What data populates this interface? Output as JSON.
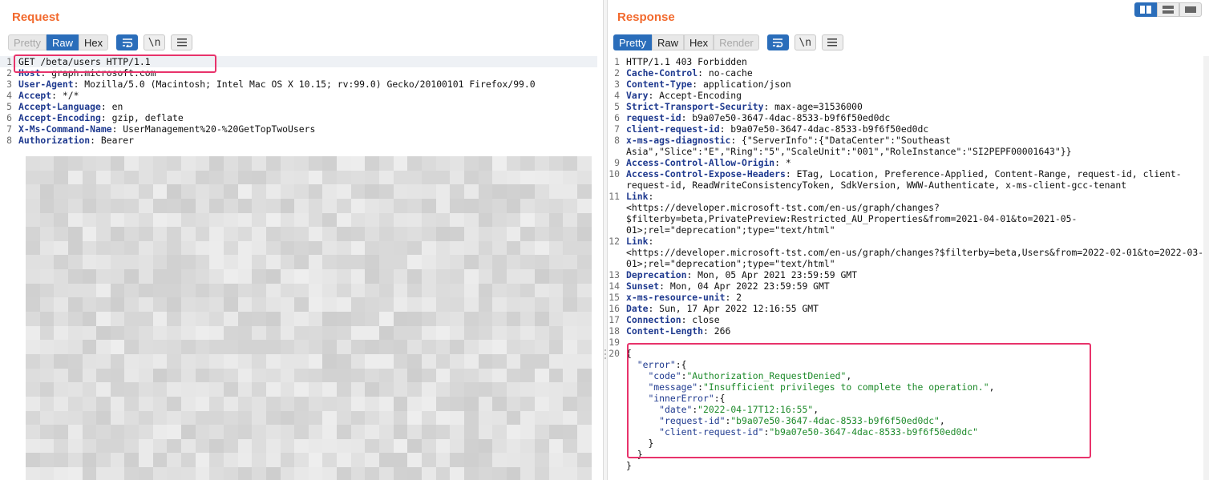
{
  "request": {
    "title": "Request",
    "tabs": [
      {
        "label": "Pretty",
        "state": "disabled"
      },
      {
        "label": "Raw",
        "state": "selected"
      },
      {
        "label": "Hex",
        "state": "normal"
      }
    ],
    "tool_icons": [
      "wrap-lines-icon",
      "newline-icon",
      "menu-icon"
    ],
    "lines": [
      {
        "n": "1",
        "segs": [
          {
            "t": "GET /beta/users HTTP/1.1"
          }
        ]
      },
      {
        "n": "2",
        "segs": [
          {
            "t": "Host",
            "c": "k"
          },
          {
            "t": ": graph.microsoft.com"
          }
        ]
      },
      {
        "n": "3",
        "segs": [
          {
            "t": "User-Agent",
            "c": "k"
          },
          {
            "t": ": Mozilla/5.0 (Macintosh; Intel Mac OS X 10.15; rv:99.0) Gecko/20100101 Firefox/99.0"
          }
        ]
      },
      {
        "n": "4",
        "segs": [
          {
            "t": "Accept",
            "c": "k"
          },
          {
            "t": ": */*"
          }
        ]
      },
      {
        "n": "5",
        "segs": [
          {
            "t": "Accept-Language",
            "c": "k"
          },
          {
            "t": ": en"
          }
        ]
      },
      {
        "n": "6",
        "segs": [
          {
            "t": "Accept-Encoding",
            "c": "k"
          },
          {
            "t": ": gzip, deflate"
          }
        ]
      },
      {
        "n": "7",
        "segs": [
          {
            "t": "X-Ms-Command-Name",
            "c": "k"
          },
          {
            "t": ": UserManagement%20-%20GetTopTwoUsers"
          }
        ]
      },
      {
        "n": "8",
        "segs": [
          {
            "t": "Authorization",
            "c": "k"
          },
          {
            "t": ": Bearer"
          }
        ]
      }
    ]
  },
  "response": {
    "title": "Response",
    "tabs": [
      {
        "label": "Pretty",
        "state": "selected"
      },
      {
        "label": "Raw",
        "state": "normal"
      },
      {
        "label": "Hex",
        "state": "normal"
      },
      {
        "label": "Render",
        "state": "disabled"
      }
    ],
    "tool_icons": [
      "wrap-lines-icon",
      "newline-icon",
      "menu-icon"
    ],
    "lines": [
      {
        "n": "1",
        "segs": [
          {
            "t": "HTTP/1.1 403 Forbidden"
          }
        ]
      },
      {
        "n": "2",
        "segs": [
          {
            "t": "Cache-Control",
            "c": "k"
          },
          {
            "t": ": no-cache"
          }
        ]
      },
      {
        "n": "3",
        "segs": [
          {
            "t": "Content-Type",
            "c": "k"
          },
          {
            "t": ": application/json"
          }
        ]
      },
      {
        "n": "4",
        "segs": [
          {
            "t": "Vary",
            "c": "k"
          },
          {
            "t": ": Accept-Encoding"
          }
        ]
      },
      {
        "n": "5",
        "segs": [
          {
            "t": "Strict-Transport-Security",
            "c": "k"
          },
          {
            "t": ": max-age=31536000"
          }
        ]
      },
      {
        "n": "6",
        "segs": [
          {
            "t": "request-id",
            "c": "k"
          },
          {
            "t": ": b9a07e50-3647-4dac-8533-b9f6f50ed0dc"
          }
        ]
      },
      {
        "n": "7",
        "segs": [
          {
            "t": "client-request-id",
            "c": "k"
          },
          {
            "t": ": b9a07e50-3647-4dac-8533-b9f6f50ed0dc"
          }
        ]
      },
      {
        "n": "8",
        "segs": [
          {
            "t": "x-ms-ags-diagnostic",
            "c": "k"
          },
          {
            "t": ": {\"ServerInfo\":{\"DataCenter\":\"Southeast Asia\",\"Slice\":\"E\",\"Ring\":\"5\",\"ScaleUnit\":\"001\",\"RoleInstance\":\"SI2PEPF00001643\"}}"
          }
        ]
      },
      {
        "n": "9",
        "segs": [
          {
            "t": "Access-Control-Allow-Origin",
            "c": "k"
          },
          {
            "t": ": *"
          }
        ]
      },
      {
        "n": "10",
        "segs": [
          {
            "t": "Access-Control-Expose-Headers",
            "c": "k"
          },
          {
            "t": ": ETag, Location, Preference-Applied, Content-Range, request-id, client-request-id, ReadWriteConsistencyToken, SdkVersion, WWW-Authenticate, x-ms-client-gcc-tenant"
          }
        ]
      },
      {
        "n": "11",
        "segs": [
          {
            "t": "Link",
            "c": "k"
          },
          {
            "t": ":\n<https://developer.microsoft-tst.com/en-us/graph/changes?$filterby=beta,PrivatePreview:Restricted_AU_Properties&from=2021-04-01&to=2021-05-01>;rel=\"deprecation\";type=\"text/html\""
          }
        ]
      },
      {
        "n": "12",
        "segs": [
          {
            "t": "Link",
            "c": "k"
          },
          {
            "t": ":\n<https://developer.microsoft-tst.com/en-us/graph/changes?$filterby=beta,Users&from=2022-02-01&to=2022-03-01>;rel=\"deprecation\";type=\"text/html\""
          }
        ]
      },
      {
        "n": "13",
        "segs": [
          {
            "t": "Deprecation",
            "c": "k"
          },
          {
            "t": ": Mon, 05 Apr 2021 23:59:59 GMT"
          }
        ]
      },
      {
        "n": "14",
        "segs": [
          {
            "t": "Sunset",
            "c": "k"
          },
          {
            "t": ": Mon, 04 Apr 2022 23:59:59 GMT"
          }
        ]
      },
      {
        "n": "15",
        "segs": [
          {
            "t": "x-ms-resource-unit",
            "c": "k"
          },
          {
            "t": ": 2"
          }
        ]
      },
      {
        "n": "16",
        "segs": [
          {
            "t": "Date",
            "c": "k"
          },
          {
            "t": ": Sun, 17 Apr 2022 12:16:55 GMT"
          }
        ]
      },
      {
        "n": "17",
        "segs": [
          {
            "t": "Connection",
            "c": "k"
          },
          {
            "t": ": close"
          }
        ]
      },
      {
        "n": "18",
        "segs": [
          {
            "t": "Content-Length",
            "c": "k"
          },
          {
            "t": ": 266"
          }
        ]
      },
      {
        "n": "19",
        "segs": [
          {
            "t": ""
          }
        ]
      },
      {
        "n": "20",
        "segs": [
          {
            "t": "{"
          }
        ]
      },
      {
        "n": "",
        "segs": [
          {
            "t": "  "
          },
          {
            "t": "\"error\"",
            "c": "jk"
          },
          {
            "t": ":{"
          }
        ]
      },
      {
        "n": "",
        "segs": [
          {
            "t": "    "
          },
          {
            "t": "\"code\"",
            "c": "jk"
          },
          {
            "t": ":"
          },
          {
            "t": "\"Authorization_RequestDenied\"",
            "c": "jv"
          },
          {
            "t": ","
          }
        ]
      },
      {
        "n": "",
        "segs": [
          {
            "t": "    "
          },
          {
            "t": "\"message\"",
            "c": "jk"
          },
          {
            "t": ":"
          },
          {
            "t": "\"Insufficient privileges to complete the operation.\"",
            "c": "jv"
          },
          {
            "t": ","
          }
        ]
      },
      {
        "n": "",
        "segs": [
          {
            "t": "    "
          },
          {
            "t": "\"innerError\"",
            "c": "jk"
          },
          {
            "t": ":{"
          }
        ]
      },
      {
        "n": "",
        "segs": [
          {
            "t": "      "
          },
          {
            "t": "\"date\"",
            "c": "jk"
          },
          {
            "t": ":"
          },
          {
            "t": "\"2022-04-17T12:16:55\"",
            "c": "jv"
          },
          {
            "t": ","
          }
        ]
      },
      {
        "n": "",
        "segs": [
          {
            "t": "      "
          },
          {
            "t": "\"request-id\"",
            "c": "jk"
          },
          {
            "t": ":"
          },
          {
            "t": "\"b9a07e50-3647-4dac-8533-b9f6f50ed0dc\"",
            "c": "jv"
          },
          {
            "t": ","
          }
        ]
      },
      {
        "n": "",
        "segs": [
          {
            "t": "      "
          },
          {
            "t": "\"client-request-id\"",
            "c": "jk"
          },
          {
            "t": ":"
          },
          {
            "t": "\"b9a07e50-3647-4dac-8533-b9f6f50ed0dc\"",
            "c": "jv"
          }
        ]
      },
      {
        "n": "",
        "segs": [
          {
            "t": "    }"
          }
        ]
      },
      {
        "n": "",
        "segs": [
          {
            "t": "  }"
          }
        ]
      },
      {
        "n": "",
        "segs": [
          {
            "t": "}"
          }
        ]
      }
    ]
  },
  "layout_modes": [
    "split-view-icon",
    "stacked-view-icon",
    "single-view-icon"
  ],
  "colors": {
    "accent": "#2a6dba",
    "title": "#f26a2e",
    "header_key": "#1f3a8f",
    "json_value": "#1d8a2a",
    "highlight_box": "#e8336b"
  }
}
